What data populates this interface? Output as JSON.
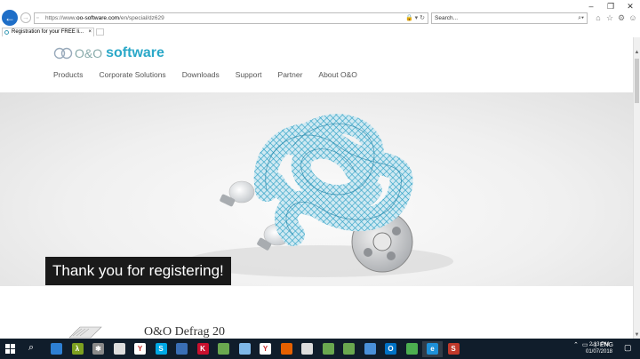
{
  "window": {
    "controls": [
      "–",
      "❐",
      "✕"
    ]
  },
  "address_bar": {
    "url_prefix": "https://www.",
    "url_host": "oo-software.com",
    "url_path": "/en/special/dz629",
    "tools": "🔒 ▾ ↻"
  },
  "search": {
    "placeholder": "Search...",
    "icon": "search-icon"
  },
  "toolbar_icons": [
    "home-icon",
    "star-icon",
    "gear-icon",
    "smiley-icon"
  ],
  "tab": {
    "title": "Registration for your FREE li...",
    "close": "×"
  },
  "site": {
    "logo_mark": "O&O",
    "logo_word": "software",
    "nav": [
      "Products",
      "Corporate Solutions",
      "Downloads",
      "Support",
      "Partner",
      "About O&O"
    ],
    "hero_caption": "Thank you for registering!",
    "teaser_title": "O&O Defrag 20"
  },
  "taskbar": {
    "apps": [
      {
        "icon": "file-explorer-icon",
        "color": "#2d7fd3",
        "glyph": ""
      },
      {
        "icon": "lambda-icon",
        "color": "#7da020",
        "glyph": "λ"
      },
      {
        "icon": "settings-icon",
        "color": "#8a8a8a",
        "glyph": "✱"
      },
      {
        "icon": "copy-icon",
        "color": "#dddddd",
        "glyph": ""
      },
      {
        "icon": "yandex-icon",
        "color": "#ffffff",
        "glyph": "Y"
      },
      {
        "icon": "skype-icon",
        "color": "#00a8e6",
        "glyph": "S"
      },
      {
        "icon": "screenshot-icon",
        "color": "#3a6fb5",
        "glyph": ""
      },
      {
        "icon": "kaspersky-icon",
        "color": "#c8102e",
        "glyph": "K"
      },
      {
        "icon": "vmware-icon",
        "color": "#6aa84f",
        "glyph": ""
      },
      {
        "icon": "cloud-icon",
        "color": "#7fb8e8",
        "glyph": ""
      },
      {
        "icon": "yandex-browser-icon",
        "color": "#ffffff",
        "glyph": "Y"
      },
      {
        "icon": "firefox-icon",
        "color": "#e66000",
        "glyph": ""
      },
      {
        "icon": "display-icon",
        "color": "#dddddd",
        "glyph": ""
      },
      {
        "icon": "script-icon",
        "color": "#6aa84f",
        "glyph": ""
      },
      {
        "icon": "vmware-icon",
        "color": "#6aa84f",
        "glyph": ""
      },
      {
        "icon": "notes-icon",
        "color": "#4a90d9",
        "glyph": ""
      },
      {
        "icon": "outlook-icon",
        "color": "#0072c6",
        "glyph": "O"
      },
      {
        "icon": "network-icon",
        "color": "#4caf50",
        "glyph": ""
      },
      {
        "icon": "internet-explorer-icon",
        "color": "#1e90d8",
        "glyph": "e"
      },
      {
        "icon": "ashampoo-icon",
        "color": "#c0392b",
        "glyph": "S"
      }
    ],
    "tray_language": "ENG",
    "clock_time": "2:13 PM",
    "clock_date": "01/07/2018"
  }
}
